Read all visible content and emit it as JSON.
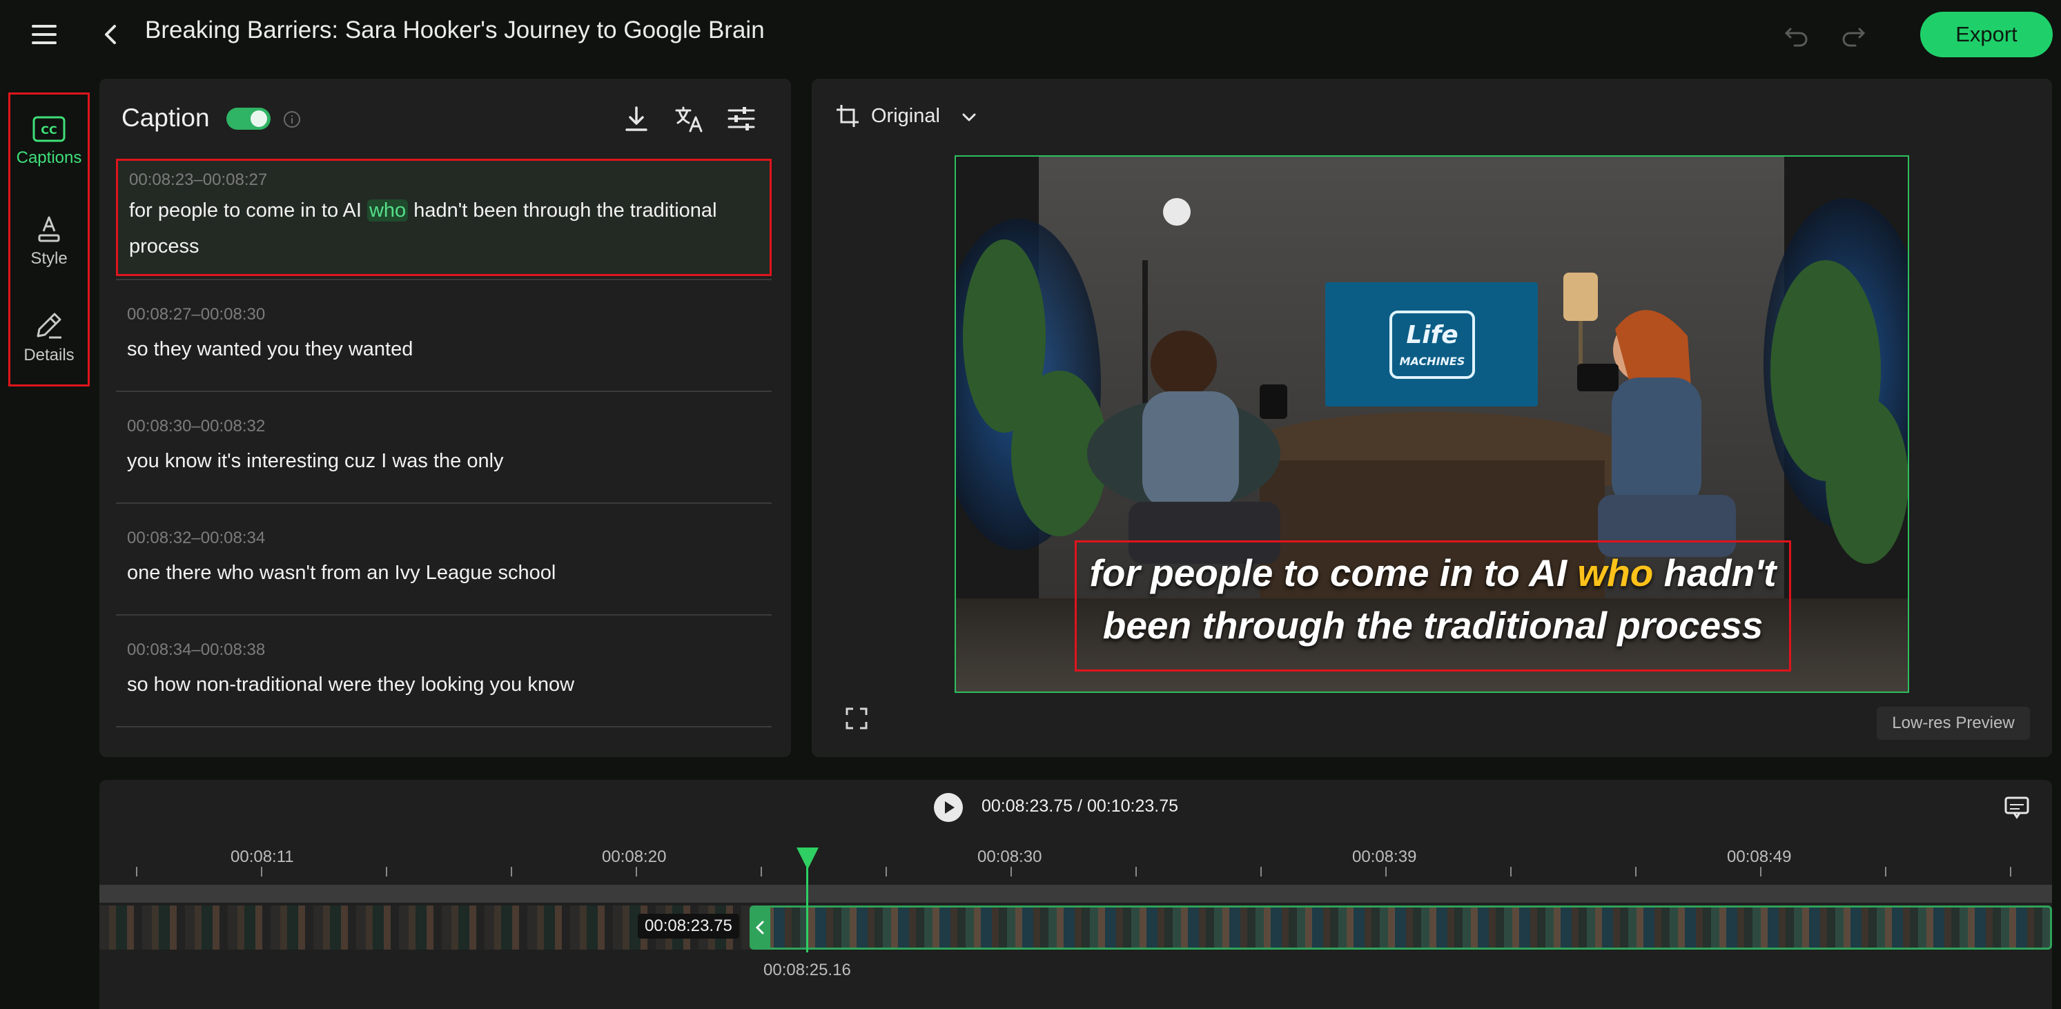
{
  "header": {
    "title": "Breaking Barriers: Sara Hooker's Journey to Google Brain",
    "export_label": "Export"
  },
  "rail": {
    "items": [
      {
        "label": "Captions",
        "icon": "cc-icon",
        "active": true
      },
      {
        "label": "Style",
        "icon": "style-icon",
        "active": false
      },
      {
        "label": "Details",
        "icon": "edit-icon",
        "active": false
      }
    ]
  },
  "captions": {
    "title": "Caption",
    "enabled": true,
    "items": [
      {
        "time": "00:08:23–00:08:27",
        "text_pre": "for people to come in to AI ",
        "highlight": "who",
        "text_post": " hadn't been through the traditional process",
        "selected": true
      },
      {
        "time": "00:08:27–00:08:30",
        "text": "so they wanted you they wanted"
      },
      {
        "time": "00:08:30–00:08:32",
        "text": "you know it's interesting cuz I was the only"
      },
      {
        "time": "00:08:32–00:08:34",
        "text": "one there who wasn't from an Ivy League school"
      },
      {
        "time": "00:08:34–00:08:38",
        "text": "so how non-traditional were they looking you know"
      }
    ]
  },
  "preview": {
    "ratio_label": "Original",
    "subtitle_line1_pre": "for people to come in to AI ",
    "subtitle_line1_hl": "who",
    "subtitle_line1_post": " hadn't",
    "subtitle_line2": "been through the traditional process",
    "screen_logo_line1": "Life",
    "screen_logo_line2": "MACHINES",
    "lowres_label": "Low-res Preview",
    "highlight_color": "#ffc21a"
  },
  "timeline": {
    "current": "00:08:23.75",
    "separator": "/",
    "total": "00:10:23.75",
    "ticks": [
      "00:08:11",
      "00:08:20",
      "00:08:30",
      "00:08:39",
      "00:08:49"
    ],
    "clip_split_time": "00:08:23.75",
    "playhead_time": "00:08:25.16"
  },
  "colors": {
    "accent": "#1fd06a",
    "selection_border": "#e0141c"
  }
}
